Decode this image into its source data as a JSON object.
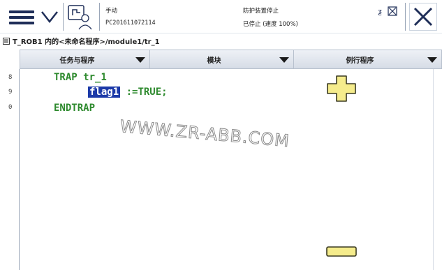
{
  "header": {
    "mode": "手动",
    "controller_id": "PC201611072114",
    "protection_status": "防护装置停止",
    "run_status": "已停止 (速度 100%)",
    "menu_icon": "hamburger-icon",
    "close_icon": "close-icon"
  },
  "breadcrumb": {
    "text": "T_ROB1 内的<未命名程序>/module1/tr_1"
  },
  "tabs": [
    {
      "label": "任务与程序"
    },
    {
      "label": "模块"
    },
    {
      "label": "例行程序"
    }
  ],
  "editor": {
    "line_numbers": [
      "8",
      "9",
      "0"
    ],
    "line_1": "TRAP tr_1",
    "line_2_highlight": "flag1",
    "line_2_rest": " :=TRUE;",
    "line_3": "ENDTRAP",
    "watermark": "WWW.ZR-ABB.COM"
  },
  "colors": {
    "code_green": "#2e8a2e",
    "selection_blue": "#1c3aa8",
    "zoom_yellow": "#f5ec8c",
    "navy": "#1f2e58"
  }
}
